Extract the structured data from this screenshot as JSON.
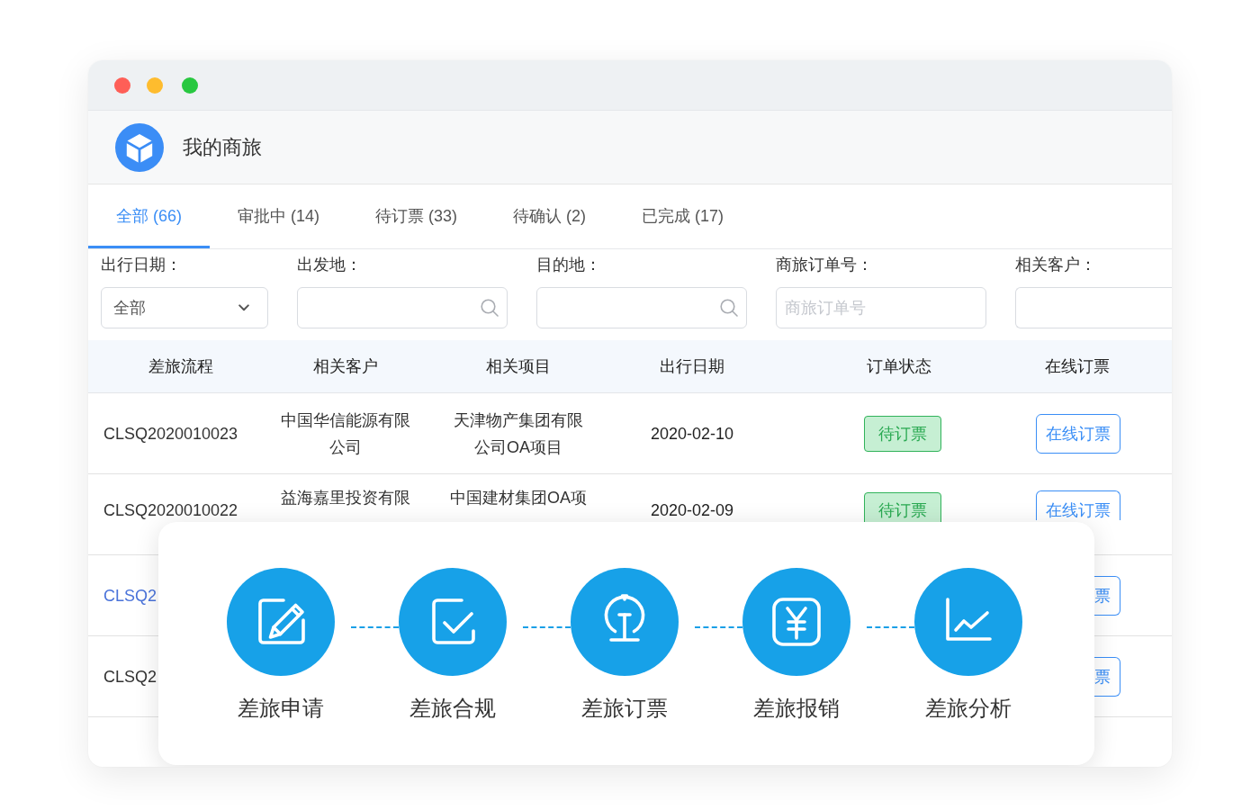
{
  "header": {
    "title": "我的商旅"
  },
  "tabs": [
    {
      "label": "全部 (66)",
      "selected": true
    },
    {
      "label": "审批中 (14)",
      "selected": false
    },
    {
      "label": "待订票 (33)",
      "selected": false
    },
    {
      "label": "待确认 (2)",
      "selected": false
    },
    {
      "label": "已完成 (17)",
      "selected": false
    }
  ],
  "filters": [
    {
      "kind": "select",
      "label": "出行日期：",
      "value": "全部"
    },
    {
      "kind": "search",
      "label": "出发地："
    },
    {
      "kind": "search",
      "label": "目的地："
    },
    {
      "kind": "text",
      "label": "商旅订单号：",
      "placeholder": "商旅订单号"
    },
    {
      "kind": "text",
      "label": "相关客户："
    }
  ],
  "table": {
    "columns": [
      "差旅流程",
      "相关客户",
      "相关项目",
      "出行日期",
      "订单状态",
      "在线订票"
    ],
    "rows": [
      {
        "kind": "whole",
        "hovered": false,
        "id": "CLSQ2020010023",
        "customer": "中国华信能源有限公司",
        "project": "天津物产集团有限公司OA项目",
        "date": "2020-02-10",
        "status": "待订票",
        "action": "在线订票"
      },
      {
        "kind": "top_half",
        "hovered": false,
        "id": "CLSQ2020010022",
        "customer": "益海嘉里投资有限",
        "project": "中国建材集团OA项",
        "date": "2020-02-09",
        "status": "待订票",
        "action": "在线订票"
      },
      {
        "kind": "ends",
        "hovered": true,
        "id": "CLSQ2",
        "action": "票"
      },
      {
        "kind": "ends",
        "hovered": false,
        "id": "CLSQ2",
        "action": "票"
      }
    ]
  },
  "process_card": {
    "steps": [
      {
        "kind": "edit",
        "label": "差旅申请"
      },
      {
        "kind": "check",
        "label": "差旅合规"
      },
      {
        "kind": "rail",
        "label": "差旅订票"
      },
      {
        "kind": "yen",
        "label": "差旅报销"
      },
      {
        "kind": "chart",
        "label": "差旅分析"
      }
    ]
  }
}
